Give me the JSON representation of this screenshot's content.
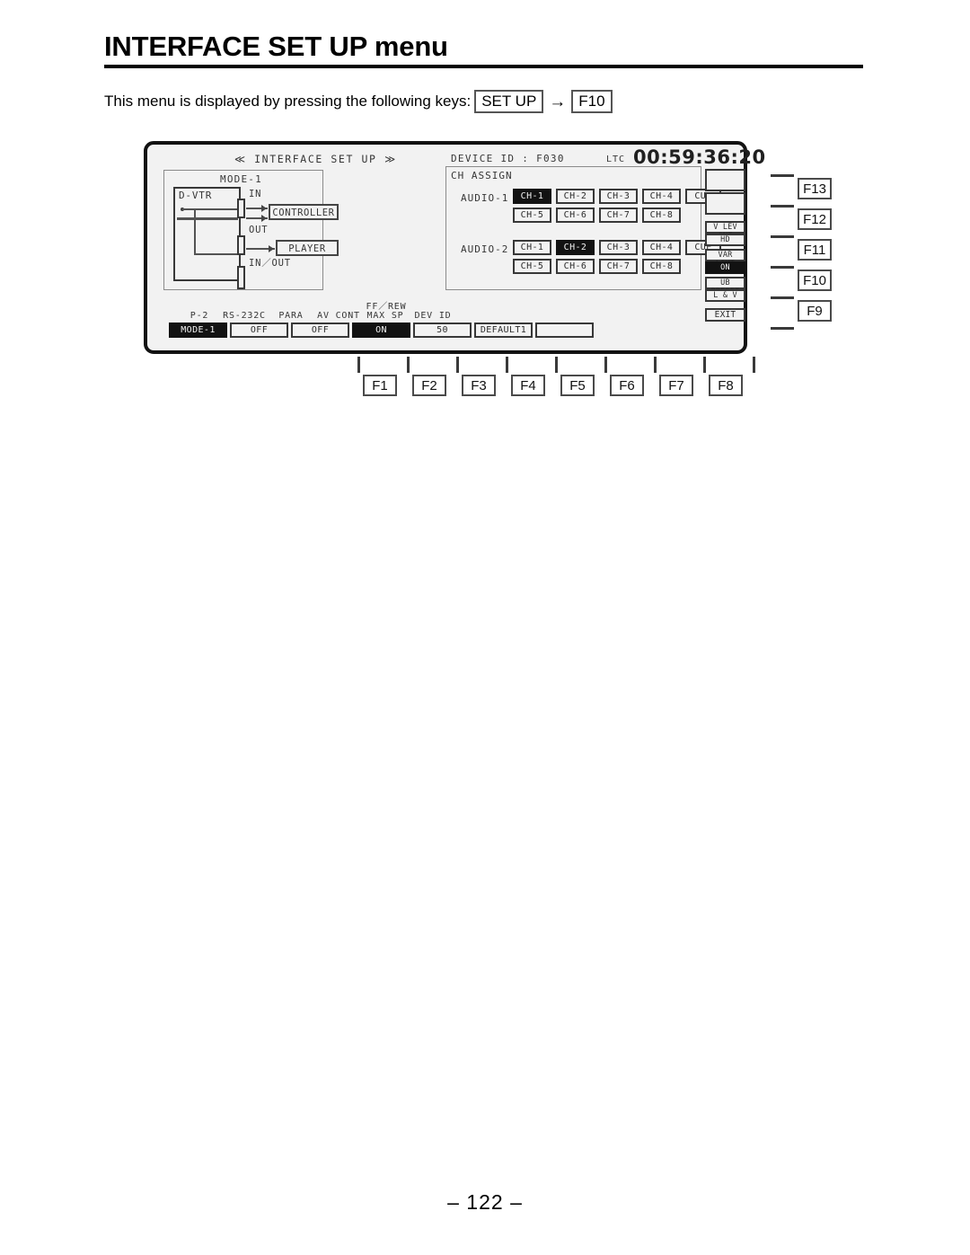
{
  "page": {
    "title": "INTERFACE SET UP menu",
    "intro_prefix": "This menu is displayed by pressing the following keys:",
    "key1": "SET UP",
    "arrow": "→",
    "key2": "F10",
    "page_number": "– 122 –"
  },
  "lcd": {
    "menu_title": "≪ INTERFACE  SET UP ≫",
    "device_id": "DEVICE ID : F030",
    "ltc_label": "LTC",
    "ltc_value": "00:59:36:20",
    "mode_diagram": {
      "mode_label": "MODE-1",
      "source": "D-VTR",
      "in_label": "IN",
      "out_label": "OUT",
      "inout_label": "IN／OUT",
      "controller": "CONTROLLER",
      "player": "PLAYER"
    },
    "ch_assign": {
      "title": "CH ASSIGN",
      "rows": [
        {
          "label": "AUDIO-1",
          "top": [
            "CH-1",
            "CH-2",
            "CH-3",
            "CH-4"
          ],
          "cue": "CUE",
          "bottom": [
            "CH-5",
            "CH-6",
            "CH-7",
            "CH-8"
          ],
          "selected": "CH-1"
        },
        {
          "label": "AUDIO-2",
          "top": [
            "CH-1",
            "CH-2",
            "CH-3",
            "CH-4"
          ],
          "cue": "CUE",
          "bottom": [
            "CH-5",
            "CH-6",
            "CH-7",
            "CH-8"
          ],
          "selected": "CH-2"
        }
      ]
    },
    "right_column": [
      {
        "name": "blank-1",
        "label": "",
        "value": "",
        "selected": false
      },
      {
        "name": "blank-2",
        "label": "",
        "value": "",
        "selected": false
      },
      {
        "name": "v-lev-cnt",
        "label": "V LEV CNT",
        "value": "HD",
        "selected": false
      },
      {
        "name": "var-limit",
        "label": "VAR LIMT",
        "value": "ON",
        "selected": true
      },
      {
        "name": "ub-preset",
        "label": "UB PRESET",
        "value": "L & V",
        "selected": false
      },
      {
        "name": "exit",
        "label": "EXIT",
        "value": "",
        "selected": false
      }
    ],
    "bottom_keys": [
      {
        "label": "P-2",
        "label2": "",
        "value": "MODE-1",
        "selected": true
      },
      {
        "label": "RS-232C",
        "label2": "",
        "value": "OFF",
        "selected": false
      },
      {
        "label": "PARA",
        "label2": "",
        "value": "OFF",
        "selected": false
      },
      {
        "label": "AV CONT",
        "label2": "",
        "value": "ON",
        "selected": true
      },
      {
        "label": "MAX SP",
        "label2": "FF／REW",
        "value": "50",
        "selected": false
      },
      {
        "label": "DEV ID",
        "label2": "",
        "value": "DEFAULT1",
        "selected": false
      },
      {
        "label": "",
        "label2": "",
        "value": "",
        "selected": false
      }
    ]
  },
  "fkeys_bottom": [
    "F1",
    "F2",
    "F3",
    "F4",
    "F5",
    "F6",
    "F7",
    "F8"
  ],
  "fkeys_right": [
    "F13",
    "F12",
    "F11",
    "F10",
    "F9"
  ]
}
